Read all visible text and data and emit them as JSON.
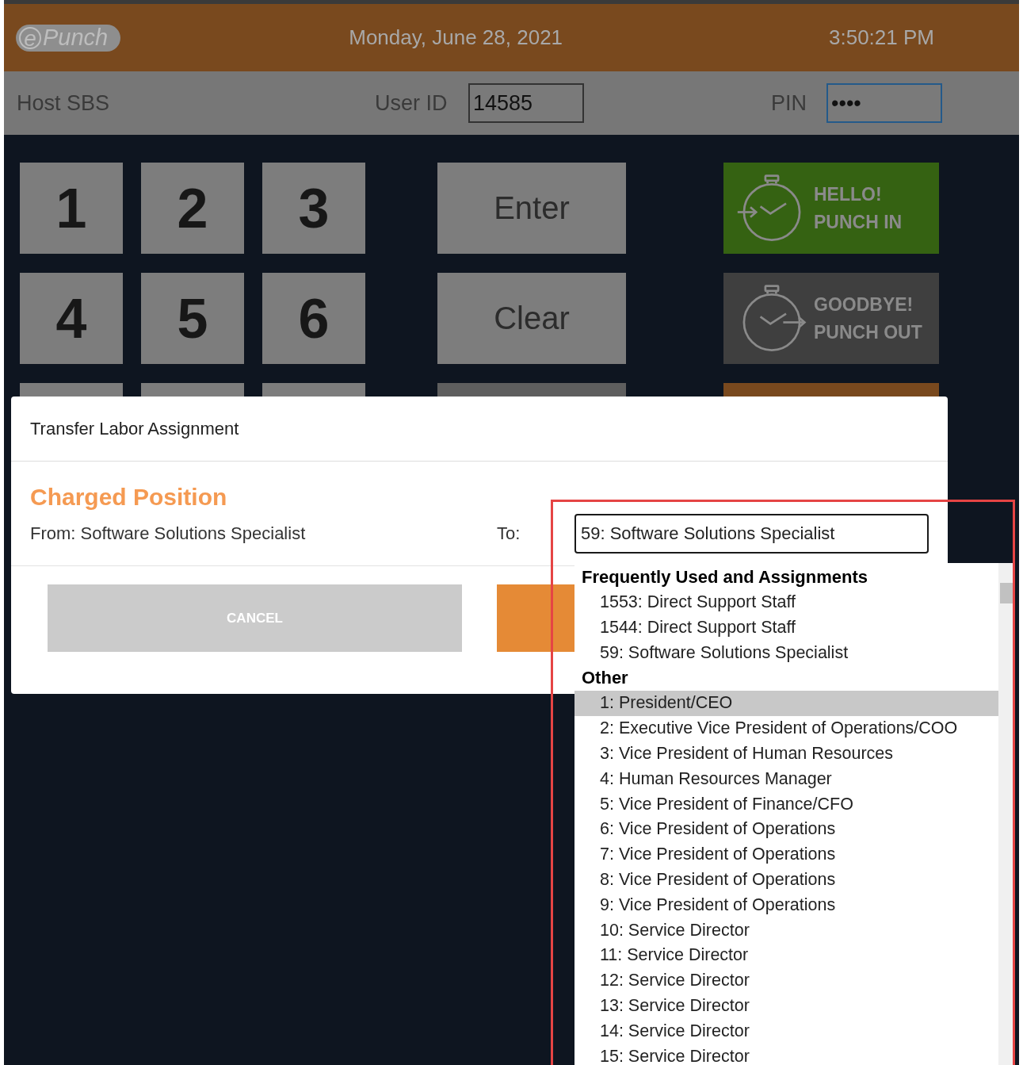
{
  "header": {
    "logo": {
      "mark": "e",
      "name": "Punch"
    },
    "date": "Monday, June 28, 2021",
    "time": "3:50:21 PM"
  },
  "login_bar": {
    "host": "Host SBS",
    "user_id_label": "User ID",
    "user_id_value": "14585",
    "pin_label": "PIN",
    "pin_value": "••••"
  },
  "keypad": {
    "rows": [
      {
        "keys": [
          "1",
          "2",
          "3"
        ],
        "action": "Enter",
        "punch": {
          "kind": "in",
          "lines": [
            "HELLO!",
            "PUNCH IN"
          ]
        }
      },
      {
        "keys": [
          "4",
          "5",
          "6"
        ],
        "action": "Clear",
        "punch": {
          "kind": "out",
          "lines": [
            "GOODBYE!",
            "PUNCH OUT"
          ]
        }
      }
    ]
  },
  "modal": {
    "title": "Transfer Labor Assignment",
    "section_title": "Charged Position",
    "from_text": "From: Software Solutions Specialist",
    "to_label": "To:",
    "select_value": "59: Software Solutions Specialist",
    "cancel_label": "CANCEL",
    "dropdown": {
      "groups": [
        {
          "label": "Frequently Used and Assignments",
          "options": [
            {
              "text": "1553: Direct Support Staff",
              "selected": false
            },
            {
              "text": "1544: Direct Support Staff",
              "selected": false
            },
            {
              "text": "59: Software Solutions Specialist",
              "selected": false
            }
          ]
        },
        {
          "label": "Other",
          "options": [
            {
              "text": "1: President/CEO",
              "selected": true
            },
            {
              "text": "2: Executive Vice President of Operations/COO",
              "selected": false
            },
            {
              "text": "3: Vice President of Human Resources",
              "selected": false
            },
            {
              "text": "4: Human Resources Manager",
              "selected": false
            },
            {
              "text": "5: Vice President of Finance/CFO",
              "selected": false
            },
            {
              "text": "6: Vice President of Operations",
              "selected": false
            },
            {
              "text": "7: Vice President of Operations",
              "selected": false
            },
            {
              "text": "8: Vice President of Operations",
              "selected": false
            },
            {
              "text": "9: Vice President of Operations",
              "selected": false
            },
            {
              "text": "10: Service Director",
              "selected": false
            },
            {
              "text": "11: Service Director",
              "selected": false
            },
            {
              "text": "12: Service Director",
              "selected": false
            },
            {
              "text": "13: Service Director",
              "selected": false
            },
            {
              "text": "14: Service Director",
              "selected": false
            },
            {
              "text": "15: Service Director",
              "selected": false
            }
          ]
        }
      ]
    }
  }
}
